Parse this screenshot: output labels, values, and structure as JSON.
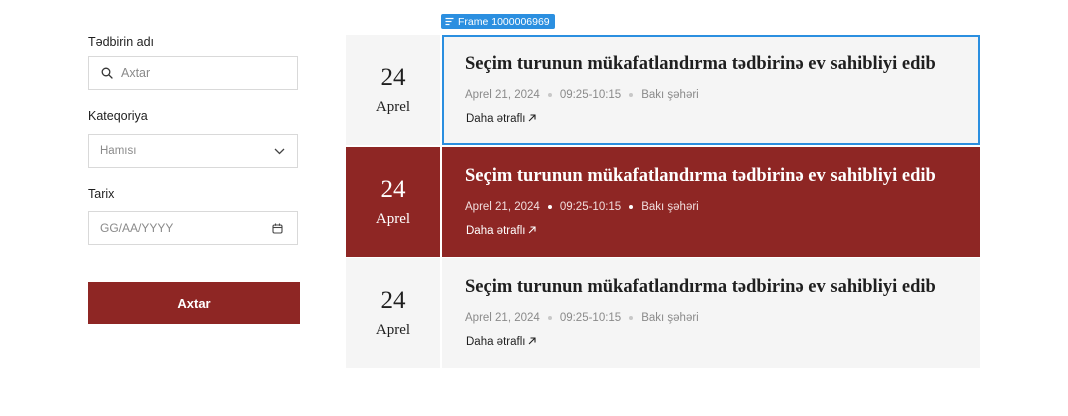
{
  "filters": {
    "event_name_label": "Tədbirin adı",
    "search_placeholder": "Axtar",
    "category_label": "Kateqoriya",
    "category_value": "Hamısı",
    "date_label": "Tarix",
    "date_placeholder": "GG/AA/YYYY",
    "search_button": "Axtar"
  },
  "frame_tag": "Frame 1000006969",
  "colors": {
    "accent": "#8e2624",
    "selection": "#2b8fe0",
    "row_bg": "#f5f5f5"
  },
  "events": [
    {
      "day": "24",
      "month": "Aprel",
      "title": "Seçim turunun mükafatlandırma tədbirinə ev sahibliyi edib",
      "date": "Aprel 21, 2024",
      "time": "09:25-10:15",
      "location": "Bakı şəhəri",
      "more": "Daha ətraflı"
    },
    {
      "day": "24",
      "month": "Aprel",
      "title": "Seçim turunun mükafatlandırma tədbirinə ev sahibliyi edib",
      "date": "Aprel 21, 2024",
      "time": "09:25-10:15",
      "location": "Bakı şəhəri",
      "more": "Daha ətraflı"
    },
    {
      "day": "24",
      "month": "Aprel",
      "title": "Seçim turunun mükafatlandırma tədbirinə ev sahibliyi edib",
      "date": "Aprel 21, 2024",
      "time": "09:25-10:15",
      "location": "Bakı şəhəri",
      "more": "Daha ətraflı"
    }
  ]
}
